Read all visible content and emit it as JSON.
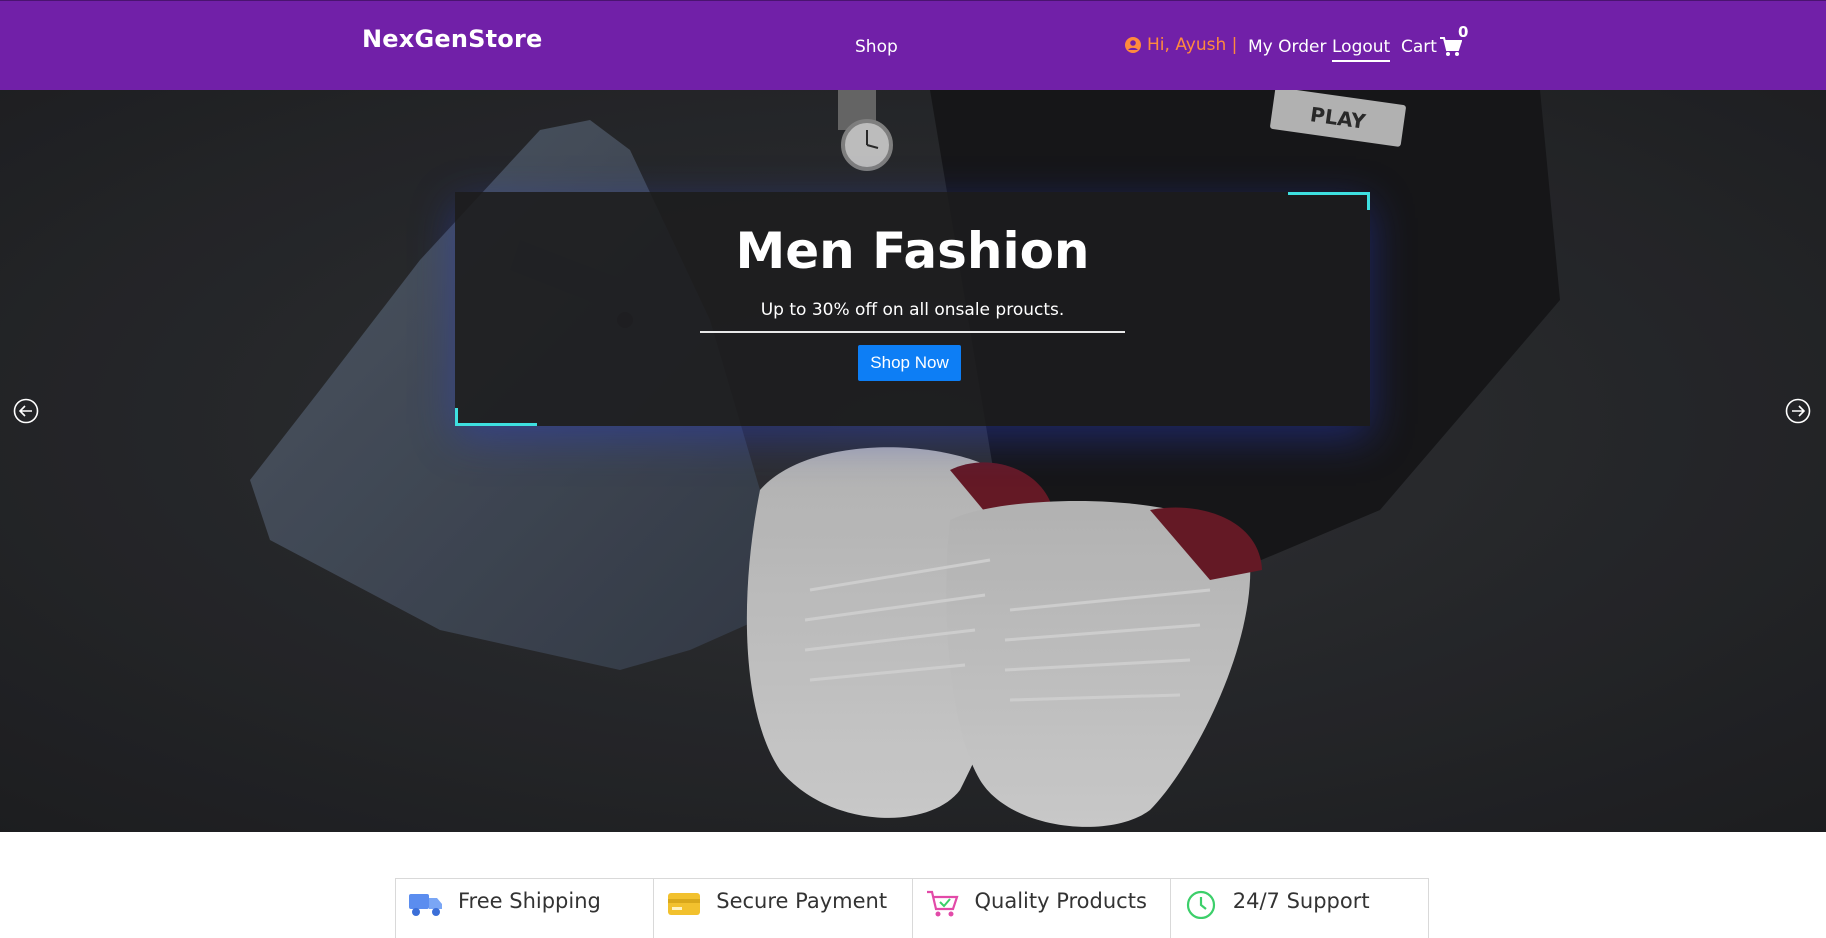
{
  "header": {
    "brand": "NexGenStore",
    "nav_shop": "Shop",
    "greeting": "Hi, Ayush |",
    "my_order": "My Order",
    "logout": "Logout",
    "cart": "Cart",
    "cart_count": "0"
  },
  "hero": {
    "title": "Men Fashion",
    "subtitle": "Up to 30% off on all onsale proucts.",
    "button": "Shop Now",
    "prev_icon": "arrow-left-circle-icon",
    "next_icon": "arrow-right-circle-icon"
  },
  "features": [
    {
      "label": "Free Shipping",
      "icon": "truck-icon",
      "color": "#5b8def"
    },
    {
      "label": "Secure Payment",
      "icon": "credit-card-icon",
      "color": "#f2c12e"
    },
    {
      "label": "Quality Products",
      "icon": "shopping-cart-icon",
      "color": "#e24aa8"
    },
    {
      "label": "24/7 Support",
      "icon": "clock-icon",
      "color": "#3ccf6a"
    }
  ],
  "colors": {
    "navbar": "#7120a8",
    "accent_button": "#0d7ef5",
    "greeting": "#ff8a3d",
    "corner_accent": "#3ee0e0"
  }
}
